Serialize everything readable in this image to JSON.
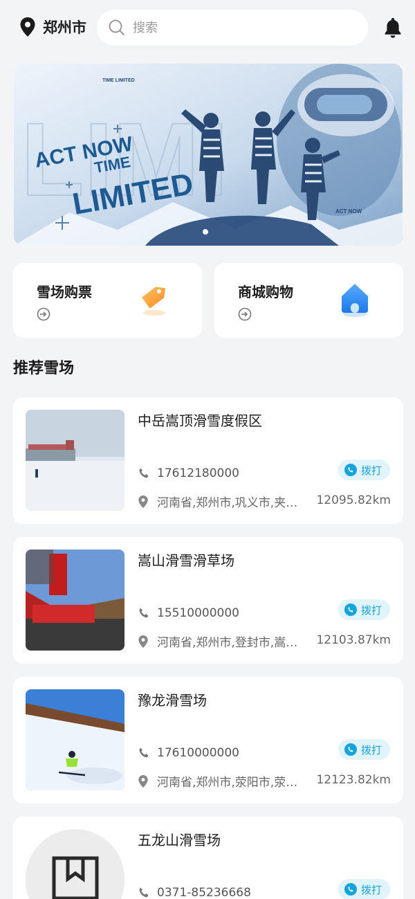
{
  "header": {
    "city": "郑州市",
    "search_placeholder": "搜索"
  },
  "banner": {
    "text_line1": "ACT NOW",
    "text_line2": "TIME",
    "text_line3": "LIMITED",
    "tag_top": "TIME LIMITED",
    "tag_bottom": "ACT NOW",
    "slide_count": 1,
    "active_slide": 1
  },
  "quick_entries": [
    {
      "label": "雪场购票",
      "icon": "ticket-tag-icon",
      "color": "#ff9a2e"
    },
    {
      "label": "商城购物",
      "icon": "shop-house-icon",
      "color": "#2e8bf0"
    }
  ],
  "section": {
    "title": "推荐雪场"
  },
  "resorts": [
    {
      "name": "中岳嵩顶滑雪度假区",
      "phone": "17612180000",
      "call_label": "拨打",
      "address": "河南省,郑州市,巩义市,夹…",
      "distance": "12095.82km"
    },
    {
      "name": "嵩山滑雪滑草场",
      "phone": "15510000000",
      "call_label": "拨打",
      "address": "河南省,郑州市,登封市,嵩…",
      "distance": "12103.87km"
    },
    {
      "name": "豫龙滑雪场",
      "phone": "17610000000",
      "call_label": "拨打",
      "address": "河南省,郑州市,荥阳市,荥…",
      "distance": "12123.82km"
    },
    {
      "name": "五龙山滑雪场",
      "phone": "0371-85236668",
      "call_label": "拨打",
      "address": "",
      "distance": ""
    }
  ],
  "colors": {
    "accent": "#14a4dc",
    "background": "#f3f4f6",
    "card": "#ffffff"
  }
}
